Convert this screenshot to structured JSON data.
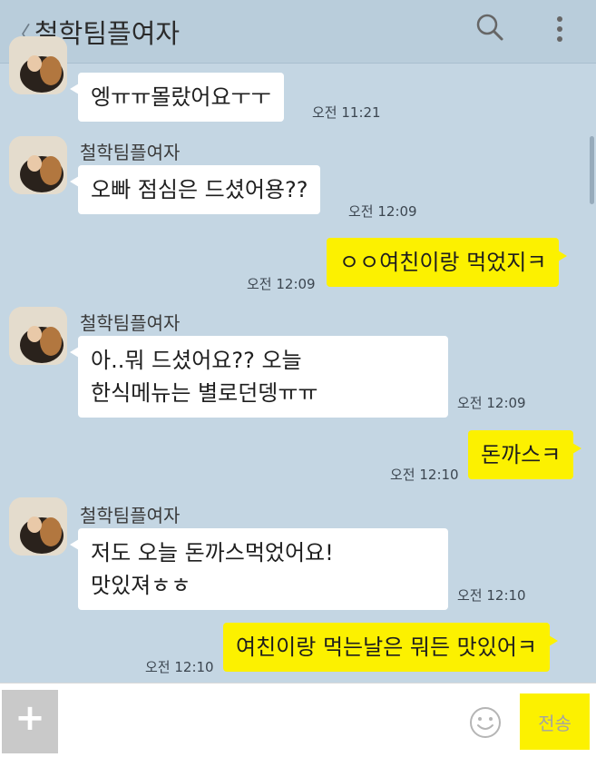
{
  "header": {
    "back_symbol": "〈",
    "title": "철학팀플여자"
  },
  "messages": [
    {
      "sender": "them",
      "name": "",
      "lines": [
        "엥ㅠㅠ몰랐어요ㅜㅜ"
      ],
      "time": "오전 11:21"
    },
    {
      "sender": "them",
      "name": "철학팀플여자",
      "lines": [
        "오빠 점심은 드셨어용??"
      ],
      "time": "오전 12:09"
    },
    {
      "sender": "me",
      "lines": [
        "ㅇㅇ여친이랑 먹었지ㅋ"
      ],
      "time": "오전 12:09"
    },
    {
      "sender": "them",
      "name": "철학팀플여자",
      "lines": [
        "아..뭐 드셨어요?? 오늘",
        "한식메뉴는 별로던뎅ㅠㅠ"
      ],
      "time": "오전 12:09"
    },
    {
      "sender": "me",
      "lines": [
        "돈까스ㅋ"
      ],
      "time": "오전 12:10"
    },
    {
      "sender": "them",
      "name": "철학팀플여자",
      "lines": [
        "저도 오늘 돈까스먹었어요!",
        "맛있져ㅎㅎ"
      ],
      "time": "오전 12:10"
    },
    {
      "sender": "me",
      "lines": [
        "여친이랑 먹는날은 뭐든 맛있어ㅋ"
      ],
      "time": "오전 12:10"
    }
  ],
  "input": {
    "plus_label": "+",
    "message_value": "",
    "send_label": "전송"
  },
  "colors": {
    "background": "#c4d6e3",
    "my_bubble": "#fcf100",
    "their_bubble": "#ffffff"
  },
  "icons": [
    "search-icon",
    "more-vertical-icon",
    "emoji-icon",
    "plus-icon"
  ]
}
